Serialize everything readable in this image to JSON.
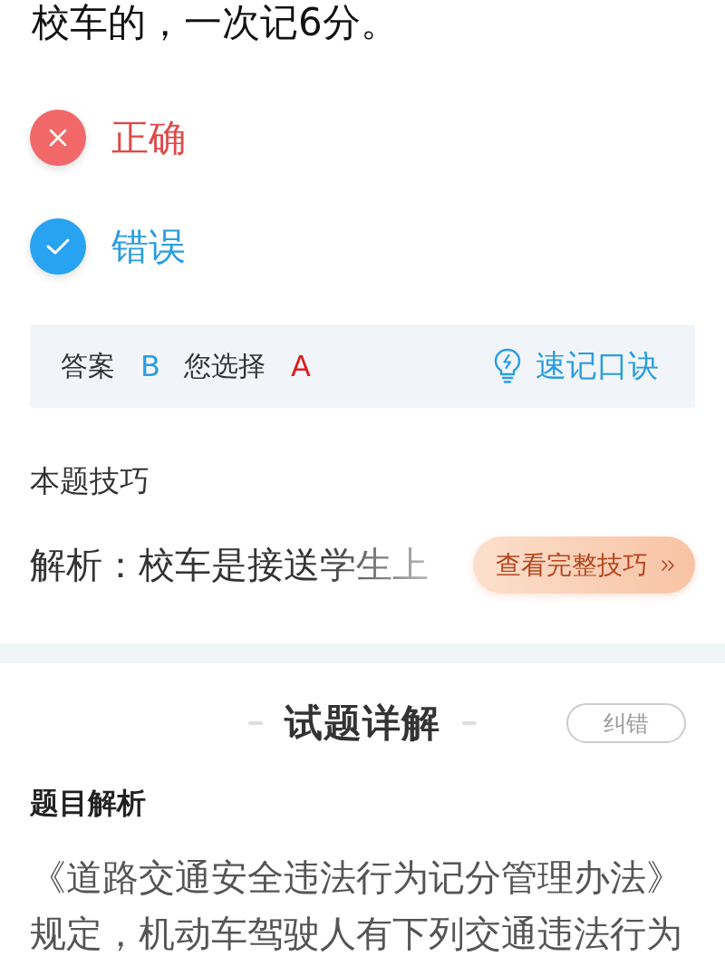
{
  "question": {
    "text": "校车的，一次记6分。"
  },
  "options": [
    {
      "label": "正确",
      "selected": true,
      "correct": false
    },
    {
      "label": "错误",
      "selected": false,
      "correct": true
    }
  ],
  "answer_bar": {
    "answer_label": "答案",
    "answer": "B",
    "choice_label": "您选择",
    "choice": "A",
    "mnemonic_link": "速记口诀"
  },
  "tip": {
    "title": "本题技巧",
    "text": "解析：校车是接送学生上",
    "button": "查看完整技巧"
  },
  "detail": {
    "title": "试题详解",
    "report_button": "纠错",
    "subtitle": "题目解析",
    "text": "《道路交通安全违法行为记分管理办法》规定，机动车驾驶人有下列交通违法行为"
  }
}
